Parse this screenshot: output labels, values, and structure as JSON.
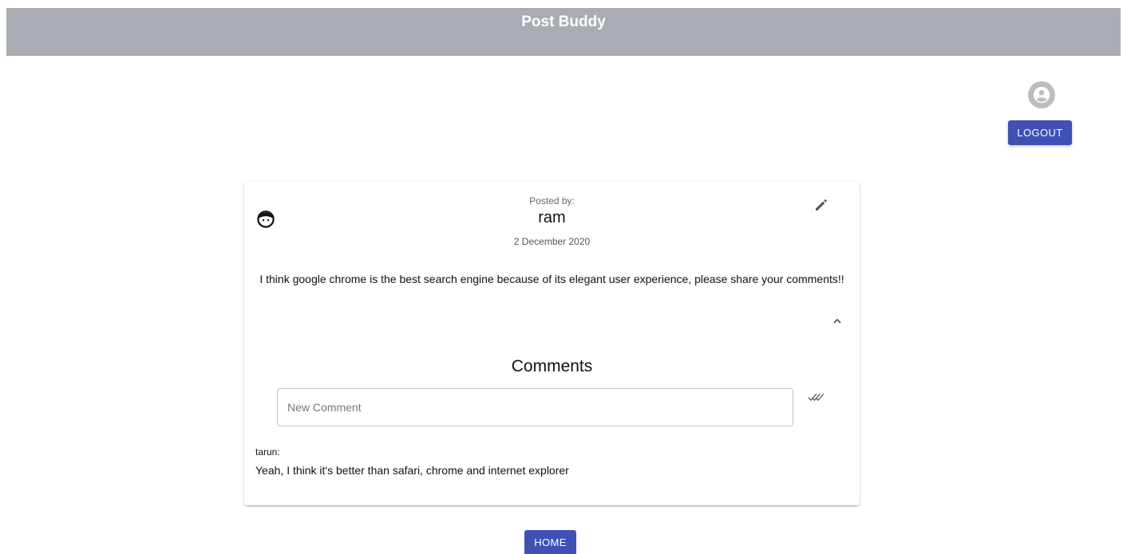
{
  "app": {
    "title": "Post Buddy"
  },
  "topbar": {
    "avatar_icon": "account-circle-icon",
    "logout_label": "LOGOUT"
  },
  "post": {
    "avatar_icon": "face-icon",
    "posted_by_label": "Posted by:",
    "author": "ram",
    "date": "2 December 2020",
    "body": "I think google chrome is the best search engine because of its elegant user experience, please share your comments!!",
    "edit_icon": "pencil-icon",
    "collapse_icon": "chevron-up-icon"
  },
  "comments": {
    "heading": "Comments",
    "input_placeholder": "New Comment",
    "input_value": "",
    "submit_icon": "double-check-icon",
    "items": [
      {
        "author": "tarun:",
        "text": "Yeah, I think it's better than safari, chrome and internet explorer"
      }
    ]
  },
  "footer": {
    "home_label": "HOME"
  },
  "colors": {
    "header_bg": "#a9acb3",
    "primary": "#3f51b5",
    "avatar_bg": "#bdbdbd"
  }
}
